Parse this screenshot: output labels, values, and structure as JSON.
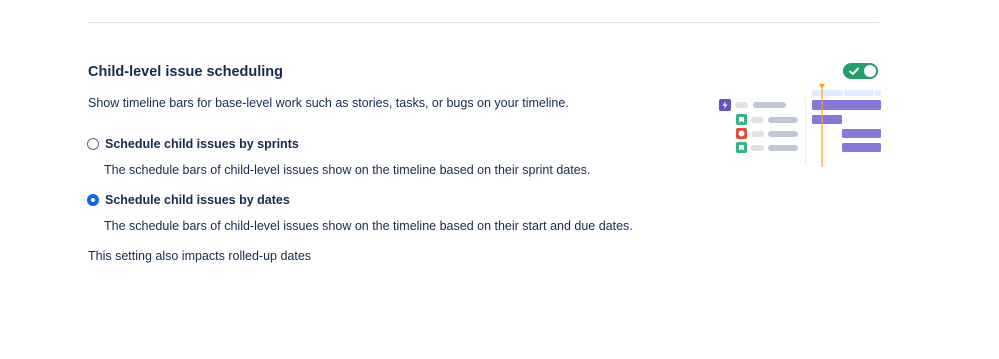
{
  "section": {
    "title": "Child-level issue scheduling",
    "description": "Show timeline bars for base-level work such as stories, tasks, or bugs on your timeline.",
    "toggle_on": true
  },
  "options": [
    {
      "label": "Schedule child issues by sprints",
      "description": "The schedule bars of child-level issues show on the timeline based on their sprint dates.",
      "selected": false
    },
    {
      "label": "Schedule child issues by dates",
      "description": "The schedule bars of child-level issues show on the timeline based on their start and due dates.",
      "selected": true
    }
  ],
  "footnote": "This setting also impacts rolled-up dates",
  "illustration": {
    "icons": [
      "epic-lightning-icon",
      "story-icon",
      "bug-icon",
      "story-icon"
    ],
    "colors": {
      "epic": "#6554c0",
      "story": "#36b37e",
      "bug": "#e5493a",
      "bar": "#8777d9",
      "today_line": "#f5a623",
      "placeholder": "#c1c7d0"
    }
  }
}
